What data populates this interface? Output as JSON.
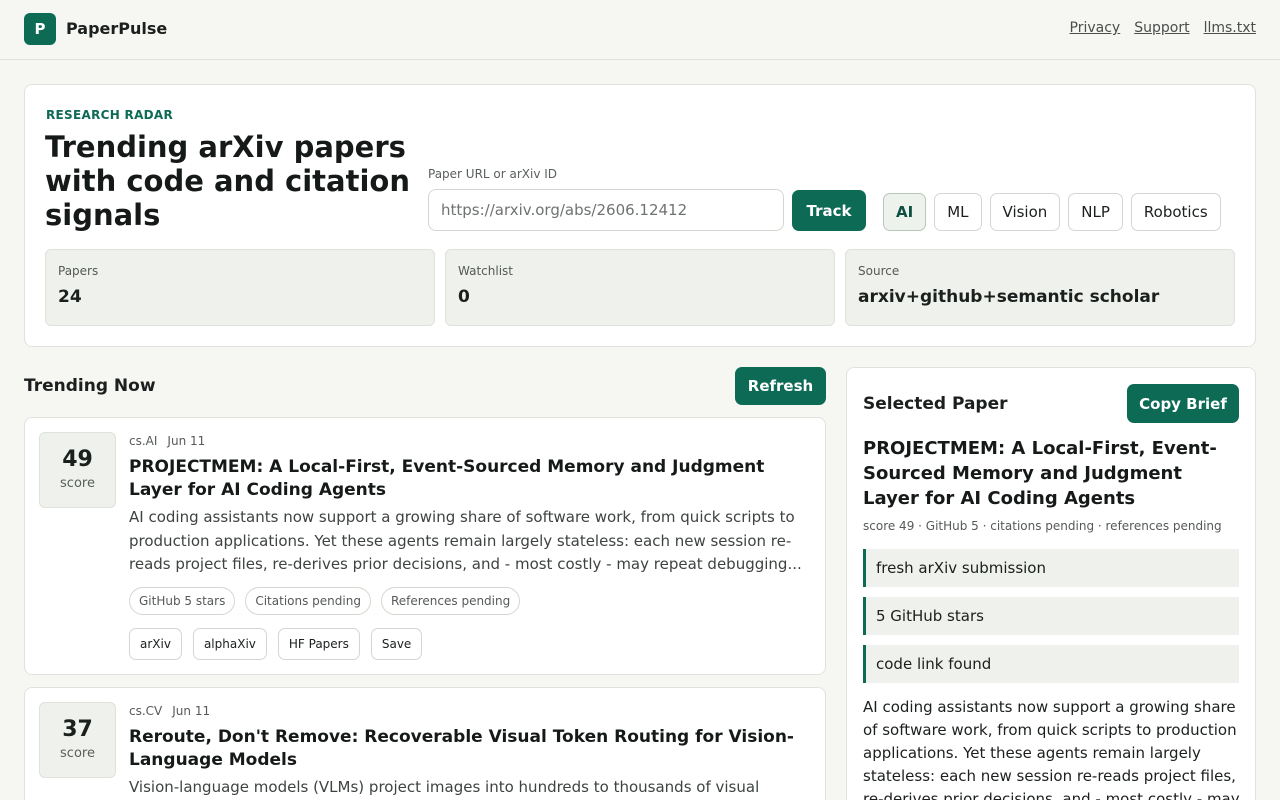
{
  "header": {
    "logo_letter": "P",
    "brand": "PaperPulse",
    "links": [
      "Privacy",
      "Support",
      "llms.txt"
    ]
  },
  "hero": {
    "eyebrow": "RESEARCH RADAR",
    "title": "Trending arXiv papers with code and citation signals",
    "input_label": "Paper URL or arXiv ID",
    "input_placeholder": "https://arxiv.org/abs/2606.12412",
    "track_label": "Track",
    "categories": [
      "AI",
      "ML",
      "Vision",
      "NLP",
      "Robotics"
    ],
    "active_category": "AI",
    "stats": [
      {
        "label": "Papers",
        "value": "24"
      },
      {
        "label": "Watchlist",
        "value": "0"
      },
      {
        "label": "Source",
        "value": "arxiv+github+semantic scholar"
      }
    ]
  },
  "trending": {
    "title": "Trending Now",
    "refresh_label": "Refresh",
    "papers": [
      {
        "score": "49",
        "score_label": "score",
        "category": "cs.AI",
        "date": "Jun 11",
        "title": "PROJECTMEM: A Local-First, Event-Sourced Memory and Judgment Layer for AI Coding Agents",
        "abstract": "AI coding assistants now support a growing share of software work, from quick scripts to production applications. Yet these agents remain largely stateless: each new session re-reads project files, re-derives prior decisions, and - most costly - may repeat debugging...",
        "tags": [
          "GitHub 5 stars",
          "Citations pending",
          "References pending"
        ],
        "actions": [
          "arXiv",
          "alphaXiv",
          "HF Papers",
          "Save"
        ]
      },
      {
        "score": "37",
        "score_label": "score",
        "category": "cs.CV",
        "date": "Jun 11",
        "title": "Reroute, Don't Remove: Recoverable Visual Token Routing for Vision-Language Models",
        "abstract": "Vision-language models (VLMs) project images into hundreds to thousands of visual"
      }
    ]
  },
  "selected": {
    "heading": "Selected Paper",
    "copy_label": "Copy Brief",
    "title": "PROJECTMEM: A Local-First, Event-Sourced Memory and Judgment Layer for AI Coding Agents",
    "meta": "score 49 · GitHub 5 · citations pending · references pending",
    "signals": [
      "fresh arXiv submission",
      "5 GitHub stars",
      "code link found"
    ],
    "abstract": "AI coding assistants now support a growing share of software work, from quick scripts to production applications. Yet these agents remain largely stateless: each new session re-reads project files, re-derives prior decisions, and - most costly - may"
  },
  "colors": {
    "accent": "#0d6a55",
    "background": "#f6f6f3",
    "panel_tint": "#eef1ec"
  }
}
